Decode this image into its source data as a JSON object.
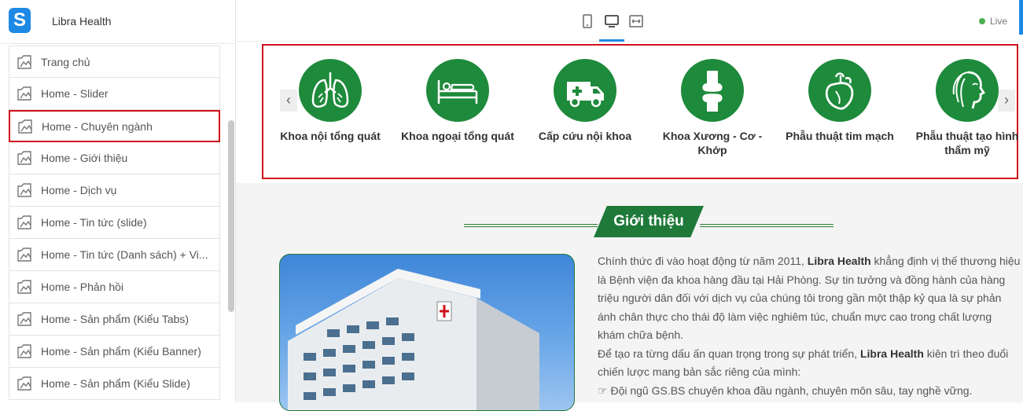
{
  "app": {
    "name": "Libra Health",
    "logo_letter": "S"
  },
  "sidebar": {
    "items": [
      {
        "label": "Trang chủ"
      },
      {
        "label": "Home - Slider"
      },
      {
        "label": "Home - Chuyên ngành",
        "selected": true
      },
      {
        "label": "Home - Giới thiệu"
      },
      {
        "label": "Home - Dịch vụ"
      },
      {
        "label": "Home - Tin tức (slide)"
      },
      {
        "label": "Home - Tin tức (Danh sách) + Vi..."
      },
      {
        "label": "Home - Phản hồi"
      },
      {
        "label": "Home - Sản phẩm (Kiểu Tabs)"
      },
      {
        "label": "Home - Sản phẩm (Kiểu Banner)"
      },
      {
        "label": "Home - Sản phẩm (Kiểu Slide)"
      }
    ]
  },
  "topbar": {
    "devices": [
      "mobile-icon",
      "desktop-icon",
      "fullwidth-icon"
    ],
    "active_device": "desktop",
    "status": "Live",
    "status_color": "#4caf50",
    "accent_color": "#1e88e5"
  },
  "specialties": {
    "items": [
      {
        "label": "Khoa nội tổng quát",
        "icon": "lungs-icon"
      },
      {
        "label": "Khoa ngoại tổng quát",
        "icon": "hospital-bed-icon"
      },
      {
        "label": "Cấp cứu nội khoa",
        "icon": "ambulance-icon"
      },
      {
        "label": "Khoa Xương - Cơ - Khớp",
        "icon": "knee-bone-icon"
      },
      {
        "label": "Phẫu thuật tim mạch",
        "icon": "heart-icon"
      },
      {
        "label": "Phẫu thuật tạo hình thẩm mỹ",
        "icon": "beauty-face-icon"
      }
    ],
    "prev_symbol": "‹",
    "next_symbol": "›",
    "brand_green": "#1e8a3b"
  },
  "intro": {
    "title": "Giới thiệu",
    "p1_a": "Chính thức đi vào hoạt động từ năm 2011, ",
    "p1_b": "Libra Health",
    "p1_c": " khẳng định vị thế thương hiệu là Bệnh viện đa khoa hàng đầu tại Hải Phòng. Sự tin tưởng và đồng hành của hàng triệu người dân đối với dịch vụ của chúng tôi trong gần một thập kỷ qua là sự phản ánh chân thực cho thái độ làm việc nghiêm túc, chuẩn mực cao trong chất lượng khám chữa bệnh.",
    "p2_a": "Để tạo ra từng dấu ấn quan trọng trong sự phát triển, ",
    "p2_b": "Libra Health",
    "p2_c": " kiên trì theo đuổi chiến lược mang bản sắc riêng của mình:",
    "bullet_symbol": "☞",
    "bullet_1": " Đội ngũ GS.BS chuyên khoa đầu ngành, chuyên môn sâu, tay nghề vững."
  }
}
